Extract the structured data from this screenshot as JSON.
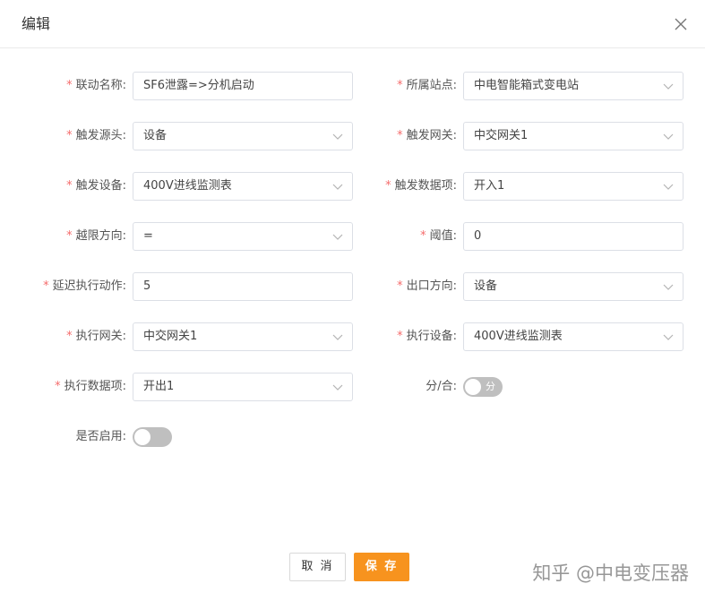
{
  "dialog": {
    "title": "编辑",
    "close_icon": "close-icon"
  },
  "form": {
    "required_mark": "*",
    "rows": [
      {
        "left": {
          "label": "联动名称:",
          "required": true,
          "value": "SF6泄露=>分机启动",
          "type": "input"
        },
        "right": {
          "label": "所属站点:",
          "required": true,
          "value": "中电智能箱式变电站",
          "type": "select"
        }
      },
      {
        "left": {
          "label": "触发源头:",
          "required": true,
          "value": "设备",
          "type": "select"
        },
        "right": {
          "label": "触发网关:",
          "required": true,
          "value": "中交网关1",
          "type": "select"
        }
      },
      {
        "left": {
          "label": "触发设备:",
          "required": true,
          "value": "400V进线监测表",
          "type": "select"
        },
        "right": {
          "label": "触发数据项:",
          "required": true,
          "value": "开入1",
          "type": "select"
        }
      },
      {
        "left": {
          "label": "越限方向:",
          "required": true,
          "value": "=",
          "type": "select"
        },
        "right": {
          "label": "阈值:",
          "required": true,
          "value": "0",
          "type": "input"
        }
      },
      {
        "left": {
          "label": "延迟执行动作:",
          "required": true,
          "value": "5",
          "type": "input"
        },
        "right": {
          "label": "出口方向:",
          "required": true,
          "value": "设备",
          "type": "select"
        }
      },
      {
        "left": {
          "label": "执行网关:",
          "required": true,
          "value": "中交网关1",
          "type": "select"
        },
        "right": {
          "label": "执行设备:",
          "required": true,
          "value": "400V进线监测表",
          "type": "select"
        }
      },
      {
        "left": {
          "label": "执行数据项:",
          "required": true,
          "value": "开出1",
          "type": "select"
        },
        "right": {
          "label": "分/合:",
          "required": false,
          "type": "switch",
          "switch_text": "分",
          "on": false
        }
      },
      {
        "left": {
          "label": "是否启用:",
          "required": false,
          "type": "switch",
          "switch_text": "",
          "on": false
        }
      }
    ]
  },
  "footer": {
    "cancel_label": "取 消",
    "save_label": "保 存",
    "save_color": "#f7931e"
  },
  "watermark": "知乎 @中电变压器"
}
